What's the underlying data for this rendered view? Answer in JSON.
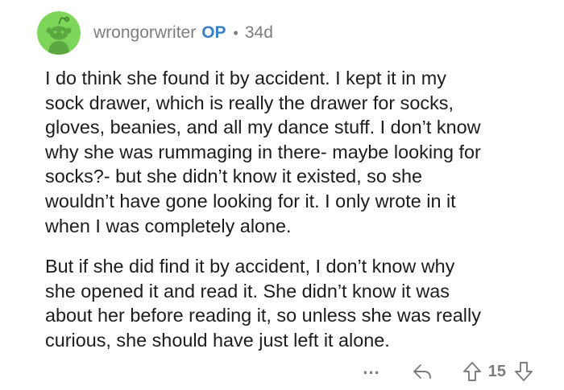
{
  "comment": {
    "author": "wrongorwriter",
    "badge": "OP",
    "separator": "•",
    "age": "34d",
    "avatar_icon": "snoo-avatar-icon",
    "avatar_color": "#7dd65a",
    "paragraphs": [
      "I do think she found it by accident. I kept it in my\nsock drawer, which is really the drawer for socks,\ngloves, beanies, and all my dance stuff. I don’t know\nwhy she was rummaging in there- maybe looking for\nsocks?- but she didn’t know it existed, so she\nwouldn’t have gone looking for it. I only wrote in it\nwhen I was completely alone.",
      "But if she did find it by accident, I don’t know why\nshe opened it and read it. She didn’t know it was\nabout her before reading it, so unless she was really\ncurious, she should have just left it alone."
    ]
  },
  "actions": {
    "more_label": "...",
    "reply_icon": "reply-icon",
    "upvote_icon": "upvote-arrow-icon",
    "score": "15",
    "downvote_icon": "downvote-arrow-icon"
  },
  "colors": {
    "op_badge": "#3a80c8",
    "meta_text": "#7c7c7c",
    "body_text": "#1c1c1c"
  }
}
